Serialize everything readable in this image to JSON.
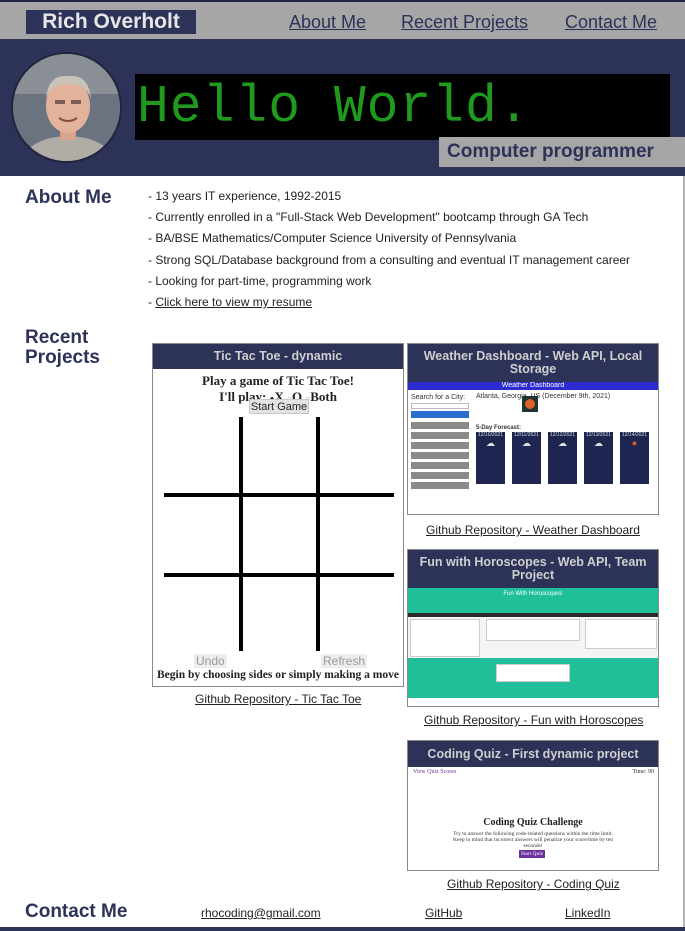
{
  "nav": {
    "brand": "Rich Overholt",
    "links": [
      "About Me",
      "Recent Projects",
      "Contact Me"
    ]
  },
  "hero": {
    "greeting": "Hello World.",
    "role": "Computer programmer"
  },
  "about": {
    "title": "About Me",
    "items": [
      "- 13 years IT experience, 1992-2015",
      "- Currently enrolled in a \"Full-Stack Web Development\" bootcamp through GA Tech",
      "- BA/BSE Mathematics/Computer Science University of Pennsylvania",
      "- Strong SQL/Database background from a consulting and eventual IT management career",
      "- Looking for part-time, programming work"
    ],
    "resume_prefix": "- ",
    "resume_link": "Click here to view my resume"
  },
  "projects": {
    "title": "Recent Projects",
    "tictactoe": {
      "header": "Tic Tac Toe - dynamic",
      "title": "Play a game of Tic Tac Toe!",
      "play_label": "I'll play:",
      "opt_x": "X",
      "opt_o": "O",
      "opt_both": "Both",
      "start": "Start Game",
      "undo": "Undo",
      "refresh": "Refresh",
      "hint": "Begin by choosing sides or simply making a move",
      "repo": "Github Repository - Tic Tac Toe"
    },
    "weather": {
      "header": "Weather Dashboard - Web API, Local Storage",
      "bar": "Weather Dashboard",
      "search_label": "Search for a City:",
      "city": "Atlanta, Georgia, US (December 9th, 2021)",
      "forecast_label": "5-Day Forecast:",
      "days": [
        "12/10/2021",
        "12/11/2021",
        "12/12/2021",
        "12/13/2021",
        "12/14/2021"
      ],
      "repo": "Github Repository - Weather Dashboard"
    },
    "horoscope": {
      "header": "Fun with Horoscopes - Web API, Team Project",
      "inner_title": "Fun With Horoscopes!",
      "repo": "Github Repository - Fun with Horoscopes"
    },
    "quiz": {
      "header": "Coding Quiz - First dynamic project",
      "view_scores": "View Quiz Scores",
      "time": "Time: 90",
      "title": "Coding Quiz Challenge",
      "desc": "Try to answer the following code-related questions within the time limit. Keep in mind that incorrect answers will penalize your score/time by ten seconds!",
      "start": "Start Quiz",
      "repo": "Github Repository - Coding Quiz"
    }
  },
  "contact": {
    "title": "Contact Me",
    "email": "rhocoding@gmail.com",
    "github": "GitHub",
    "linkedin": "LinkedIn"
  },
  "colors": {
    "navy": "#2d3258",
    "gray": "#a6a6a6",
    "terminal_green": "#1f9a1f"
  }
}
